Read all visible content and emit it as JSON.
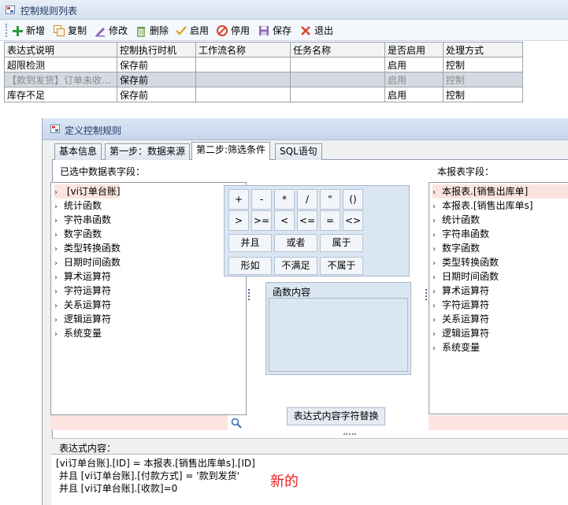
{
  "main_window": {
    "title": "控制规则列表",
    "toolbar": {
      "add": "新增",
      "copy": "复制",
      "edit": "修改",
      "delete": "删除",
      "enable": "启用",
      "disable": "停用",
      "save": "保存",
      "exit": "退出"
    },
    "grid": {
      "columns": [
        "表达式说明",
        "控制执行时机",
        "工作流名称",
        "任务名称",
        "是否启用",
        "处理方式"
      ],
      "rows": [
        [
          "超限检测",
          "保存前",
          "",
          "",
          "启用",
          "控制"
        ],
        [
          "【款到发货】订单未收...",
          "保存前",
          "",
          "",
          "启用",
          "控制"
        ],
        [
          "库存不足",
          "保存前",
          "",
          "",
          "启用",
          "控制"
        ]
      ],
      "selected_row": 1
    }
  },
  "dialog": {
    "title": "定义控制规则",
    "tabs": [
      "基本信息",
      "第一步：数据来源",
      "第二步:筛选条件",
      "SQL语句"
    ],
    "active_tab": 2,
    "left_label": "已选中数据表字段：",
    "left_tree": [
      " [vi订单台账]",
      "统计函数",
      "字符串函数",
      "数字函数",
      "类型转换函数",
      "日期时间函数",
      "算术运算符",
      "字符运算符",
      "关系运算符",
      "逻辑运算符",
      "系统变量"
    ],
    "right_label": "本报表字段：",
    "right_tree": [
      "本报表.[销售出库单]",
      "本报表.[销售出库单s]",
      "统计函数",
      "字符串函数",
      "数字函数",
      "类型转换函数",
      "日期时间函数",
      "算术运算符",
      "字符运算符",
      "关系运算符",
      "逻辑运算符",
      "系统变量"
    ],
    "operators_row1": [
      "+",
      "-",
      "*",
      "/",
      "\"",
      "()"
    ],
    "operators_row2": [
      ">",
      ">=",
      "<",
      "<=",
      "=",
      "<>"
    ],
    "operators_row3": [
      "并且",
      "或者",
      "属于"
    ],
    "operators_row4": [
      "形如",
      "不满足",
      "不属于"
    ],
    "function_panel_title": "函数内容",
    "replace_button": "表达式内容字符替换",
    "expression_label": "表达式内容：",
    "expression_lines": [
      "[vi订单台账].[ID] = 本报表.[销售出库单s].[ID]",
      " 并且 [vi订单台账].[付款方式] = '款到发货'",
      " 并且 [vi订单台账].[收款]=0"
    ],
    "annotation": "新的"
  },
  "colors": {
    "title_bar": "#d6e1f0",
    "selected_row": "#d6d9e1",
    "operator_panel": "#dbe6f3",
    "annotation": "#e8231f",
    "highlight": "#fbe4df"
  }
}
